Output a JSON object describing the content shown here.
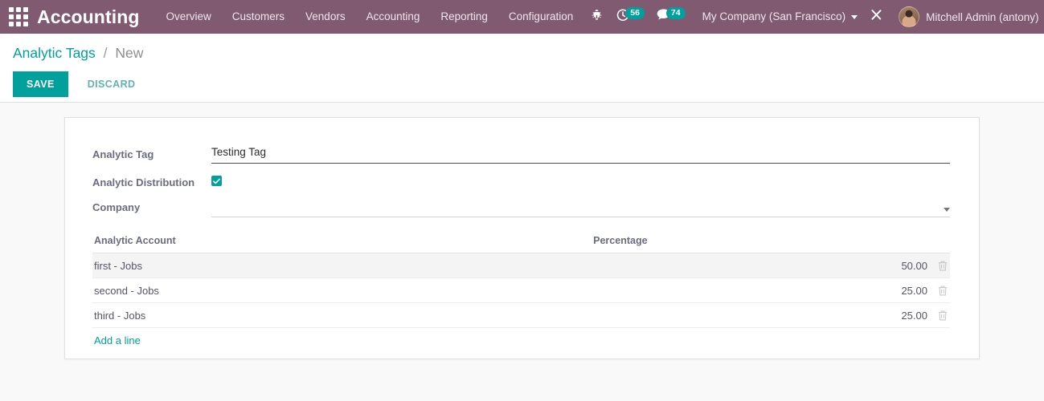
{
  "navbar": {
    "apps_icon": "apps-grid-icon",
    "brand": "Accounting",
    "menu": [
      {
        "label": "Overview"
      },
      {
        "label": "Customers"
      },
      {
        "label": "Vendors"
      },
      {
        "label": "Accounting"
      },
      {
        "label": "Reporting"
      },
      {
        "label": "Configuration"
      }
    ],
    "debug_icon": "bug-icon",
    "activity": {
      "icon": "clock-icon",
      "count": "56"
    },
    "messaging": {
      "icon": "chat-bubble-icon",
      "count": "74"
    },
    "company": "My Company (San Francisco)",
    "company_caret_icon": "chevron-down-icon",
    "shortcuts_icon": "wrench-screwdriver-icon",
    "avatar_icon": "user-avatar",
    "user": "Mitchell Admin (antony)",
    "user_caret_icon": "chevron-down-icon",
    "background_color": "#7f5a71"
  },
  "breadcrumb": {
    "parent": "Analytic Tags",
    "separator": "/",
    "current": "New"
  },
  "actions": {
    "save_label": "SAVE",
    "discard_label": "DISCARD",
    "accent_color": "#00a09d"
  },
  "form": {
    "fields": [
      {
        "label": "Analytic Tag",
        "value": "Testing Tag",
        "placeholder": ""
      },
      {
        "label": "Analytic Distribution",
        "checked": true
      },
      {
        "label": "Company",
        "value": "",
        "placeholder": ""
      }
    ],
    "analytic_tag": {
      "label": "Analytic Tag",
      "value": "Testing Tag",
      "placeholder": ""
    },
    "analytic_distribution": {
      "label": "Analytic Distribution",
      "checked": true,
      "check_icon": "check-icon"
    },
    "company": {
      "label": "Company",
      "value": "",
      "caret_icon": "chevron-down-icon"
    }
  },
  "lines_table": {
    "columns": {
      "account": "Analytic Account",
      "percentage": "Percentage"
    },
    "rows": [
      {
        "account": "first - Jobs",
        "percentage": "50.00",
        "highlighted": true,
        "delete_icon": "trash-icon"
      },
      {
        "account": "second - Jobs",
        "percentage": "25.00",
        "highlighted": false,
        "delete_icon": "trash-icon"
      },
      {
        "account": "third - Jobs",
        "percentage": "25.00",
        "highlighted": false,
        "delete_icon": "trash-icon"
      }
    ],
    "add_line_label": "Add a line"
  }
}
